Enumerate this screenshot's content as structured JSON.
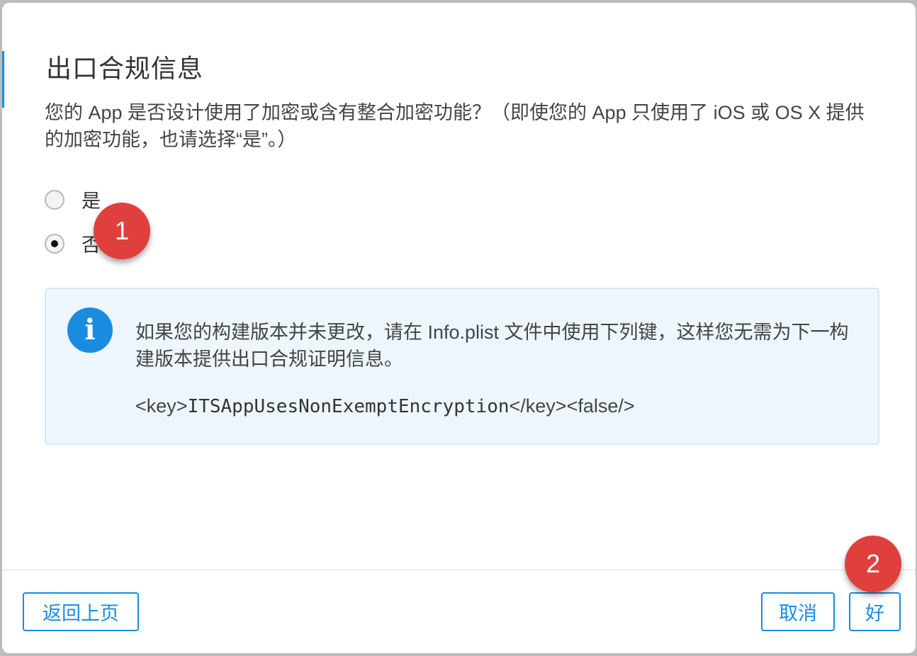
{
  "dialog": {
    "title": "出口合规信息",
    "question": "您的 App 是否设计使用了加密或含有整合加密功能？（即使您的 App 只使用了 iOS 或 OS X 提供的加密功能，也请选择“是”。）"
  },
  "options": [
    {
      "label": "是",
      "checked": false
    },
    {
      "label": "否",
      "checked": true
    }
  ],
  "info": {
    "icon": "info-icon",
    "text": "如果您的构建版本并未更改，请在 Info.plist 文件中使用下列键，这样您无需为下一构建版本提供出口合规证明信息。",
    "code_prefix": "<key>",
    "code_key": "ITSAppUsesNonExemptEncryption",
    "code_suffix": "</key><false/>"
  },
  "buttons": {
    "back": "返回上页",
    "cancel": "取消",
    "ok": "好"
  },
  "markers": {
    "first": "1",
    "second": "2"
  },
  "colors": {
    "accent": "#1a8ce0",
    "marker": "#e0403d",
    "info_bg": "#eef6fd"
  }
}
